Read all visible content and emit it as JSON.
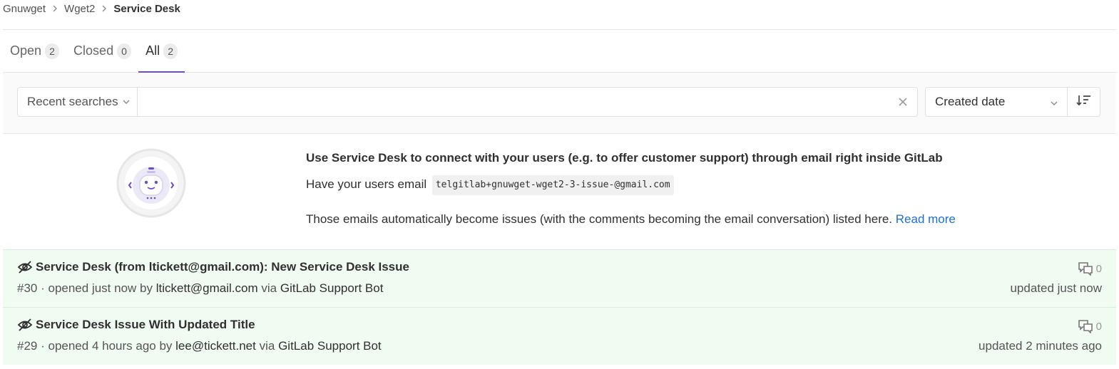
{
  "breadcrumb": {
    "items": [
      "Gnuwget",
      "Wget2"
    ],
    "current": "Service Desk"
  },
  "tabs": [
    {
      "label": "Open",
      "count": "2"
    },
    {
      "label": "Closed",
      "count": "0"
    },
    {
      "label": "All",
      "count": "2",
      "active": true
    }
  ],
  "filter": {
    "recent_searches": "Recent searches",
    "search_value": "",
    "sort_label": "Created date"
  },
  "service_desk": {
    "title": "Use Service Desk to connect with your users (e.g. to offer customer support) through email right inside GitLab",
    "email_prefix": "Have your users email",
    "email": "telgitlab+gnuwget-wget2-3-issue-@gmail.com",
    "description": "Those emails automatically become issues (with the comments becoming the email conversation) listed here.",
    "read_more": "Read more"
  },
  "issues": [
    {
      "title": "Service Desk (from ltickett@gmail.com): New Service Desk Issue",
      "number": "#30",
      "opened": "· opened just now by",
      "author": "ltickett@gmail.com",
      "via": "via",
      "via_name": "GitLab Support Bot",
      "comments": "0",
      "updated": "updated just now"
    },
    {
      "title": "Service Desk Issue With Updated Title",
      "number": "#29",
      "opened": "· opened 4 hours ago by",
      "author": "lee@tickett.net",
      "via": "via",
      "via_name": "GitLab Support Bot",
      "comments": "0",
      "updated": "updated 2 minutes ago"
    }
  ],
  "colors": {
    "accent": "#6b4fbb",
    "link": "#1f70cc",
    "issue_bg": "#f0fbf1"
  },
  "icons": [
    "chevron-right-icon",
    "chevron-down-icon",
    "close-icon",
    "sort-direction-icon",
    "eye-slash-icon",
    "comments-icon",
    "service-desk-robot-icon"
  ]
}
